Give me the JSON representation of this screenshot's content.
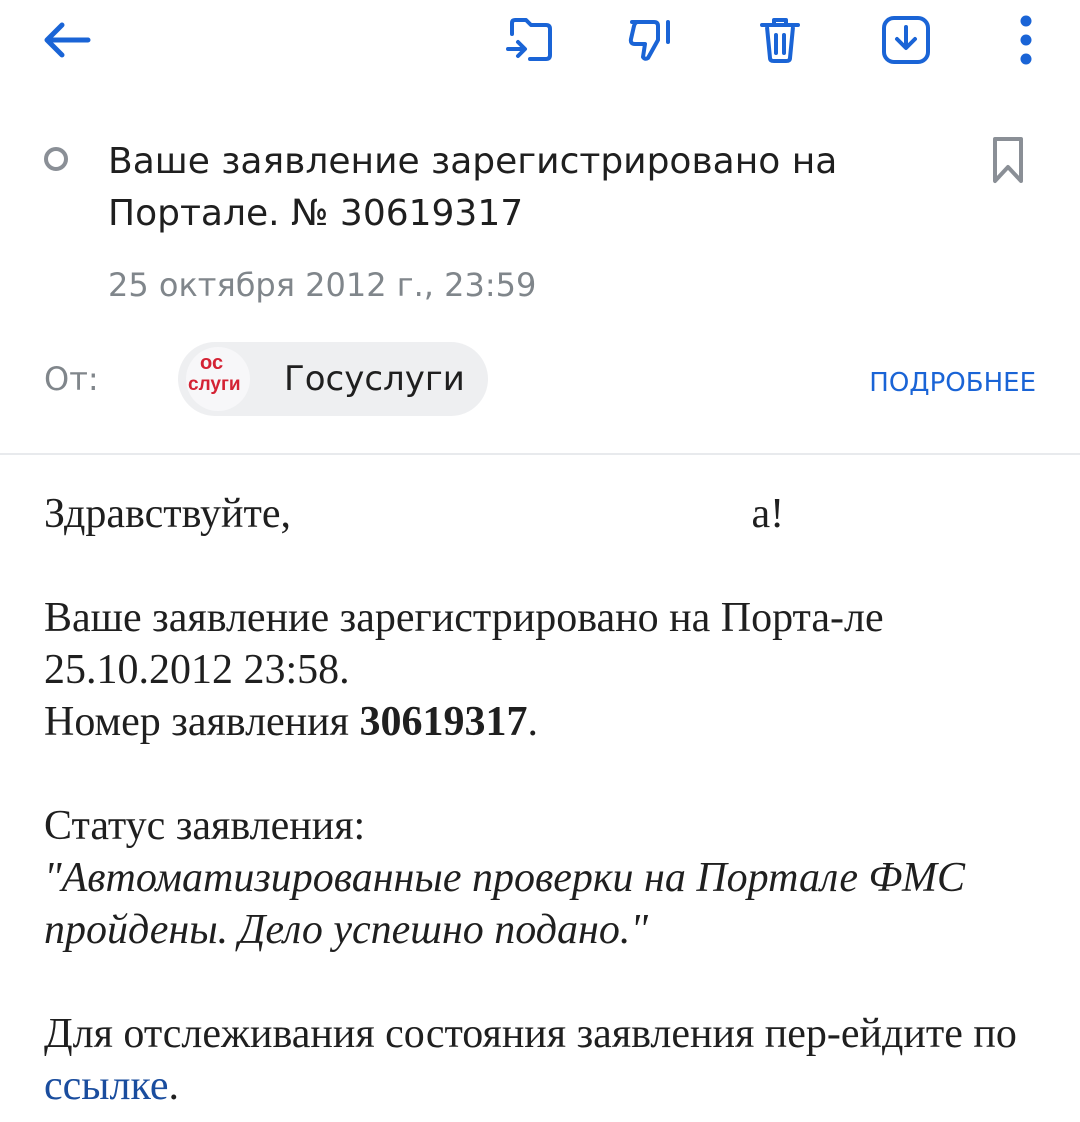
{
  "toolbar": {
    "back_icon": "back-arrow-icon",
    "move_icon": "move-to-folder-icon",
    "spam_icon": "spam-icon",
    "delete_icon": "trash-icon",
    "save_icon": "download-icon",
    "more_icon": "more-vert-icon",
    "accent_color": "#1a64d6"
  },
  "header": {
    "subject": "Ваше заявление зарегистрировано на Портале. № 30619317",
    "date": "25 октября 2012 г., 23:59",
    "from_label": "От:",
    "sender": {
      "logo_line1": "ос",
      "logo_line2": "слуги",
      "name": "Госуслуги"
    },
    "details_label": "ПОДРОБНЕЕ"
  },
  "body": {
    "greeting_start": "Здравствуйте,",
    "greeting_end": "а!",
    "registered_text": "Ваше заявление зарегистрировано на Порта-ле 25.10.2012 23:58.",
    "number_label": "Номер заявления",
    "number_value": "30619317",
    "number_end": ".",
    "status_label": "Статус заявления:",
    "status_value": "\"Автоматизированные проверки на Портале ФМС пройдены. Дело успешно подано.\"",
    "track_text": "Для отслеживания состояния заявления пер-ейдите по",
    "link_text": "ссылке",
    "track_end": "."
  }
}
